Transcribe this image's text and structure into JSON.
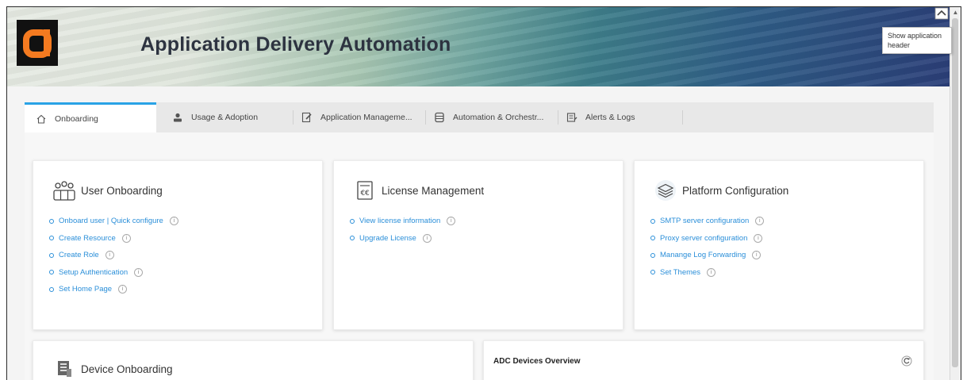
{
  "header": {
    "title": "Application Delivery Automation",
    "logo_icon": "a-logo-icon",
    "collapse_icon": "chevron-up-icon",
    "tooltip": "Show application header"
  },
  "tabs": [
    {
      "label": "Onboarding",
      "icon": "home-icon",
      "active": true
    },
    {
      "label": "Usage & Adoption",
      "icon": "user-icon",
      "active": false
    },
    {
      "label": "Application Manageme...",
      "icon": "edit-icon",
      "active": false
    },
    {
      "label": "Automation & Orchestr...",
      "icon": "database-icon",
      "active": false
    },
    {
      "label": "Alerts & Logs",
      "icon": "log-icon",
      "active": false
    }
  ],
  "cards": {
    "user_onboarding": {
      "title": "User Onboarding",
      "icon": "users-icon",
      "links": [
        "Onboard user | Quick configure",
        "Create Resource",
        "Create Role",
        "Setup Authentication",
        "Set Home Page"
      ]
    },
    "license_management": {
      "title": "License Management",
      "icon": "license-icon",
      "links": [
        "View license information",
        "Upgrade License"
      ]
    },
    "platform_configuration": {
      "title": "Platform Configuration",
      "icon": "layers-icon",
      "links": [
        "SMTP server configuration",
        "Proxy server configuration",
        "Manange Log Forwarding",
        "Set Themes"
      ]
    },
    "device_onboarding": {
      "title": "Device Onboarding",
      "icon": "device-icon"
    },
    "adc_overview": {
      "title": "ADC Devices Overview",
      "icon": "refresh-icon"
    }
  },
  "info_glyph": "i",
  "colors": {
    "accent": "#2aa3e6",
    "link": "#2b8fd9",
    "logo_orange": "#f47a20"
  }
}
